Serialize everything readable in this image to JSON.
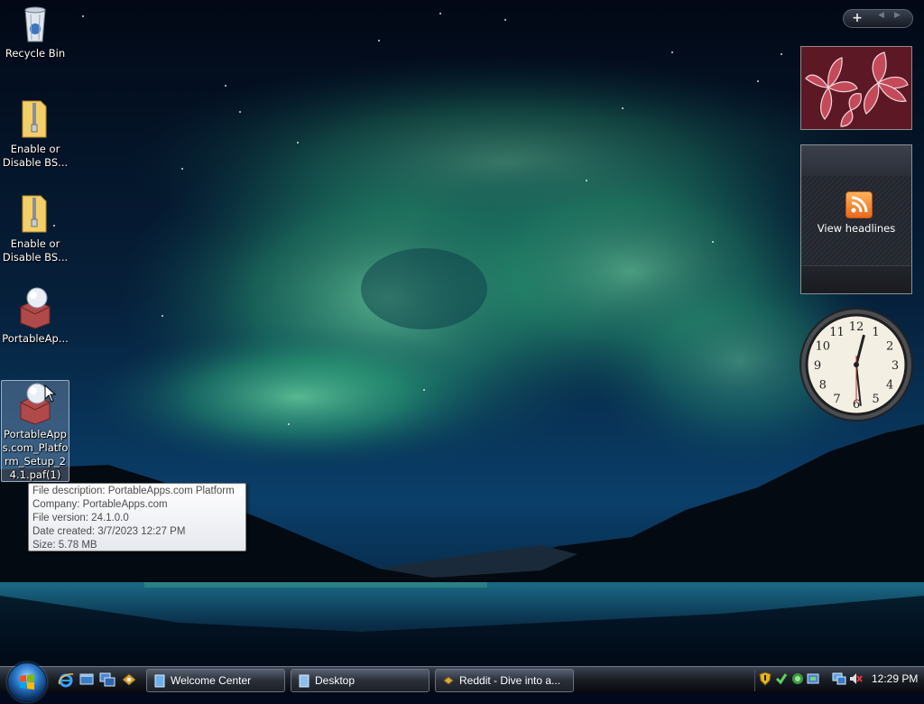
{
  "desktop": {
    "icons": [
      {
        "label": "Recycle Bin"
      },
      {
        "label": "Enable or Disable BS..."
      },
      {
        "label": "Enable or Disable BS..."
      },
      {
        "label": "PortableAp..."
      },
      {
        "label": "PortableApps.com_Platform_Setup_24.1.paf(1)"
      }
    ]
  },
  "tooltip": {
    "lines": [
      "File description: PortableApps.com Platform",
      "Company: PortableApps.com",
      "File version: 24.1.0.0",
      "Date created: 3/7/2023 12:27 PM",
      "Size: 5.78 MB"
    ]
  },
  "sidebar": {
    "add_label": "+",
    "prev_label": "◀",
    "next_label": "▶",
    "feed_headlines_label": "View headlines",
    "clock": {
      "time": "12:29",
      "numerals": [
        "12",
        "1",
        "2",
        "3",
        "4",
        "5",
        "6",
        "7",
        "8",
        "9",
        "10",
        "11"
      ]
    }
  },
  "taskbar": {
    "buttons": [
      {
        "label": "Welcome Center"
      },
      {
        "label": "Desktop"
      },
      {
        "label": "Reddit - Dive into a..."
      }
    ],
    "clock": "12:29 PM"
  },
  "icons": {
    "start": "windows-start-orb",
    "quicklaunch": [
      "internet-explorer-icon",
      "show-desktop-icon",
      "switch-windows-icon",
      "network-icon"
    ],
    "tray": [
      "security-shield-icon",
      "update-icon",
      "network-status-icon",
      "device-icon",
      "display-icon",
      "volume-muted-icon"
    ]
  }
}
